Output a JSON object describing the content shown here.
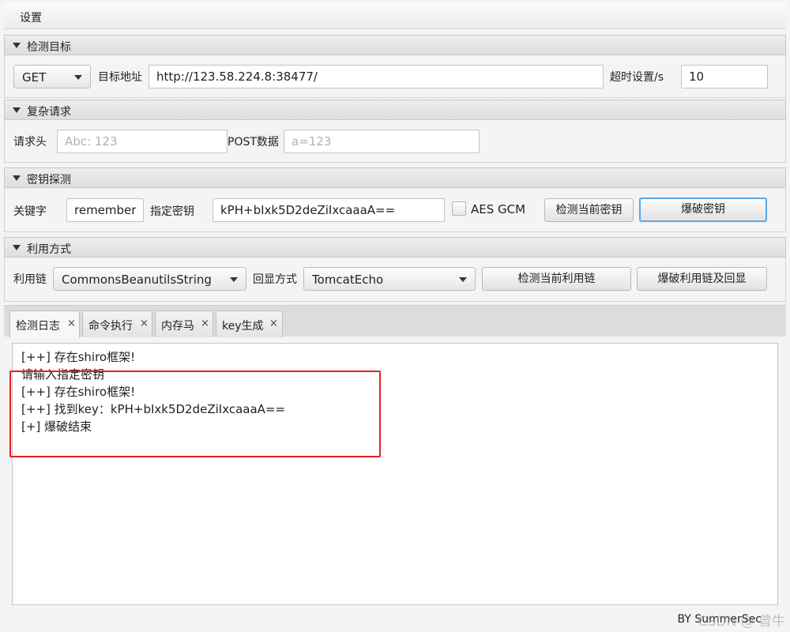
{
  "menu": {
    "settings": "设置"
  },
  "sections": {
    "target": {
      "title": "检测目标",
      "method": "GET",
      "url_label": "目标地址",
      "url_value": "http://123.58.224.8:38477/",
      "timeout_label": "超时设置/s",
      "timeout_value": "10"
    },
    "complex": {
      "title": "复杂请求",
      "header_label": "请求头",
      "header_placeholder": "Abc: 123",
      "post_label": "POST数据",
      "post_placeholder": "a=123"
    },
    "key": {
      "title": "密钥探测",
      "keyword_label": "关键字",
      "keyword_value": "rememberMe",
      "key_label": "指定密钥",
      "key_value": "kPH+bIxk5D2deZiIxcaaaA==",
      "aes_gcm_label": "AES GCM",
      "detect_button": "检测当前密钥",
      "brute_button": "爆破密钥"
    },
    "exploit": {
      "title": "利用方式",
      "chain_label": "利用链",
      "chain_value": "CommonsBeanutilsString",
      "echo_label": "回显方式",
      "echo_value": "TomcatEcho",
      "detect_chain_button": "检测当前利用链",
      "brute_chain_button": "爆破利用链及回显"
    }
  },
  "tabs": [
    {
      "label": "检测日志",
      "close": "×"
    },
    {
      "label": "命令执行",
      "close": "×"
    },
    {
      "label": "内存马",
      "close": "×"
    },
    {
      "label": "key生成",
      "close": "×"
    }
  ],
  "log": [
    "[++] 存在shiro框架!",
    "请输入指定密钥",
    "[++] 存在shiro框架!",
    "[++] 找到key：kPH+bIxk5D2deZiIxcaaaA==",
    "[+] 爆破结束"
  ],
  "footer": "BY   SummerSec",
  "watermark": "CSDN @ 曾牛"
}
